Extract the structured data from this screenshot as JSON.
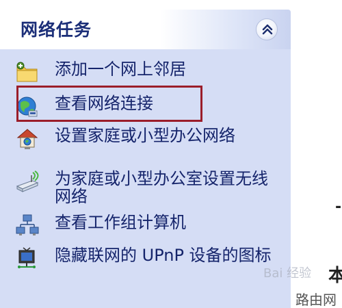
{
  "panel": {
    "title": "网络任务",
    "collapse_icon": "double-chevron-up-icon"
  },
  "tasks": [
    {
      "label": "添加一个网上邻居",
      "icon": "folder-network-icon"
    },
    {
      "label": "查看网络连接",
      "icon": "network-globe-icon"
    },
    {
      "label": "设置家庭或小型办公网络",
      "icon": "home-network-icon"
    },
    {
      "label": "为家庭或小型办公室设置无线网络",
      "icon": "wireless-router-icon"
    },
    {
      "label": "查看工作组计算机",
      "icon": "workgroup-icon"
    },
    {
      "label": "隐藏联网的 UPnP 设备的图标",
      "icon": "upnp-device-icon"
    }
  ],
  "edge": {
    "mark1": "-",
    "mark2": "本"
  },
  "watermarks": {
    "baidu": "Bai 经验",
    "luyou": "路由网"
  }
}
